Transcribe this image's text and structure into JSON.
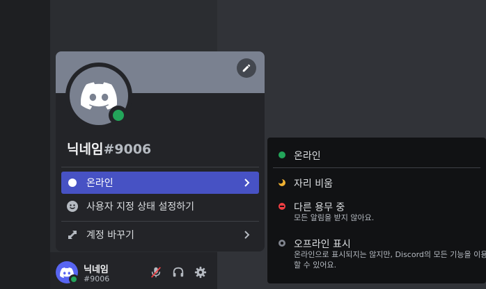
{
  "user": {
    "name": "닉네임",
    "tag": "#9006",
    "status": "online"
  },
  "popout": {
    "name": "닉네임",
    "tag": "#9006",
    "edit_icon": "pencil-icon",
    "menu": [
      {
        "label": "온라인",
        "icon": "status-dot-icon",
        "active": true,
        "has_submenu": true
      },
      {
        "label": "사용자 지정 상태 설정하기",
        "icon": "smiley-icon",
        "active": false,
        "has_submenu": false
      },
      {
        "label": "계정 바꾸기",
        "icon": "switch-account-icon",
        "active": false,
        "has_submenu": true
      }
    ]
  },
  "status_menu": [
    {
      "label": "온라인",
      "color": "#23a55a"
    },
    {
      "label": "자리 비움",
      "color": "#f0b232"
    },
    {
      "label": "다른 용무 중",
      "desc": "모든 알림을 받지 않아요.",
      "color": "#f23f43"
    },
    {
      "label": "오프라인 표시",
      "desc": "온라인으로 표시되지는 않지만, Discord의 모든 기능을 이용할 수 있어요.",
      "color": "#80848e"
    }
  ],
  "panel_buttons": [
    "mute-mic-icon",
    "headphones-icon",
    "settings-gear-icon"
  ],
  "colors": {
    "accent": "#4752c4",
    "online": "#23a55a",
    "idle": "#f0b232",
    "dnd": "#f23f43",
    "offline": "#80848e"
  }
}
